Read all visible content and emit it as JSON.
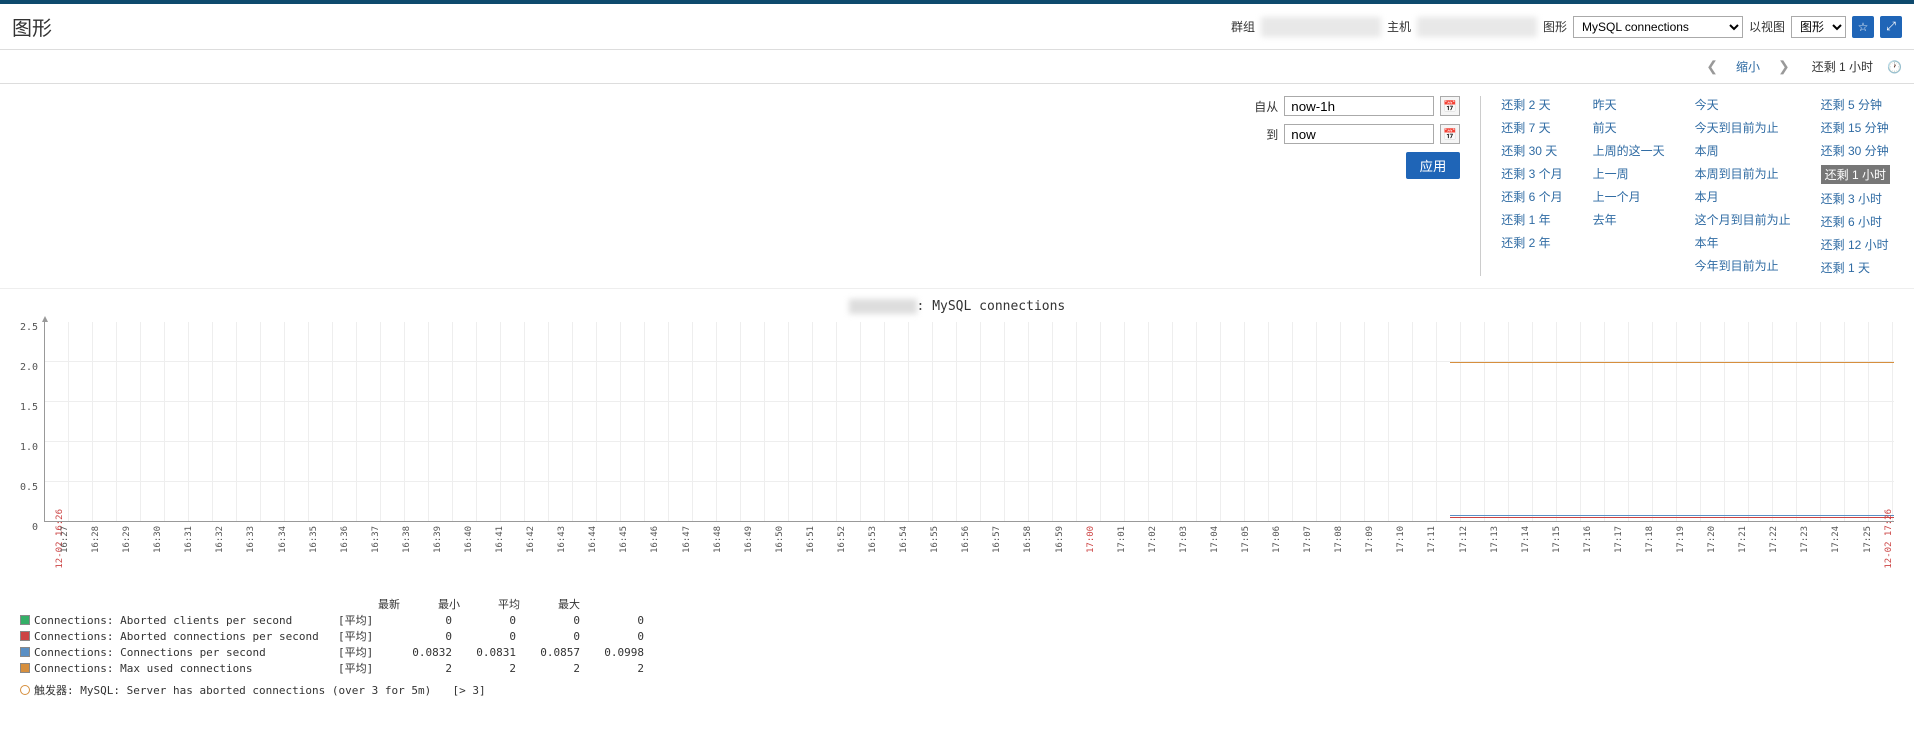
{
  "header": {
    "title": "图形",
    "group_label": "群组",
    "host_label": "主机",
    "graph_label": "图形",
    "graph_value": "MySQL connections",
    "view_label": "以视图",
    "view_value": "图形"
  },
  "timenav": {
    "zoom_out": "缩小",
    "current": "还剩 1 小时"
  },
  "timeform": {
    "from_label": "自从",
    "from_value": "now-1h",
    "to_label": "到",
    "to_value": "now",
    "apply": "应用"
  },
  "presets": {
    "col1": [
      "还剩 2 天",
      "还剩 7 天",
      "还剩 30 天",
      "还剩 3 个月",
      "还剩 6 个月",
      "还剩 1 年",
      "还剩 2 年"
    ],
    "col2": [
      "昨天",
      "前天",
      "上周的这一天",
      "上一周",
      "上一个月",
      "去年"
    ],
    "col3": [
      "今天",
      "今天到目前为止",
      "本周",
      "本周到目前为止",
      "本月",
      "这个月到目前为止",
      "本年",
      "今年到目前为止"
    ],
    "col4": [
      "还剩 5 分钟",
      "还剩 15 分钟",
      "还剩 30 分钟",
      "还剩 1 小时",
      "还剩 3 小时",
      "还剩 6 小时",
      "还剩 12 小时",
      "还剩 1 天"
    ]
  },
  "chart_data": {
    "type": "line",
    "title_suffix": ": MySQL connections",
    "ylim": [
      0,
      2.5
    ],
    "yticks": [
      "2.5",
      "2.0",
      "1.5",
      "1.0",
      "0.5",
      "0"
    ],
    "x_start_date": "12-02",
    "x_start_time": "16:26",
    "x_end_date": "12-02",
    "x_end_time": "17:26",
    "xticks": [
      "16:27",
      "16:28",
      "16:29",
      "16:30",
      "16:31",
      "16:32",
      "16:33",
      "16:34",
      "16:35",
      "16:36",
      "16:37",
      "16:38",
      "16:39",
      "16:40",
      "16:41",
      "16:42",
      "16:43",
      "16:44",
      "16:45",
      "16:46",
      "16:47",
      "16:48",
      "16:49",
      "16:50",
      "16:51",
      "16:52",
      "16:53",
      "16:54",
      "16:55",
      "16:56",
      "16:57",
      "16:58",
      "16:59",
      "17:00",
      "17:01",
      "17:02",
      "17:03",
      "17:04",
      "17:05",
      "17:06",
      "17:07",
      "17:08",
      "17:09",
      "17:10",
      "17:11",
      "17:12",
      "17:13",
      "17:14",
      "17:15",
      "17:16",
      "17:17",
      "17:18",
      "17:19",
      "17:20",
      "17:21",
      "17:22",
      "17:23",
      "17:24",
      "17:25"
    ],
    "series": [
      {
        "name": "Connections: Aborted clients per second",
        "color": "#34AF67",
        "type": "[平均]",
        "last": "0",
        "min": "0",
        "avg": "0",
        "max": "0"
      },
      {
        "name": "Connections: Aborted connections per second",
        "color": "#cc4444",
        "type": "[平均]",
        "last": "0",
        "min": "0",
        "avg": "0",
        "max": "0"
      },
      {
        "name": "Connections: Connections per second",
        "color": "#5a8fc4",
        "type": "[平均]",
        "last": "0.0832",
        "min": "0.0831",
        "avg": "0.0857",
        "max": "0.0998"
      },
      {
        "name": "Connections: Max used connections",
        "color": "#d68f3e",
        "type": "[平均]",
        "last": "2",
        "min": "2",
        "avg": "2",
        "max": "2"
      }
    ]
  },
  "legend_headers": {
    "last": "最新",
    "min": "最小",
    "avg": "平均",
    "max": "最大"
  },
  "trigger": {
    "label": "触发器: MySQL: Server has aborted connections (over 3 for 5m)",
    "threshold": "[> 3]"
  }
}
